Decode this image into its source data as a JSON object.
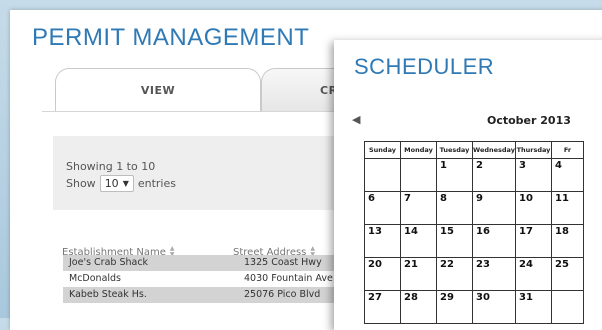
{
  "permit": {
    "title": "PERMIT MANAGEMENT",
    "tabs": [
      {
        "label": "VIEW"
      },
      {
        "label": "CRE"
      }
    ],
    "showing": "Showing 1 to 10",
    "show_label": "Show",
    "entries_value": "10",
    "entries_label": "entries",
    "columns": [
      "Establishment Name",
      "Street Address"
    ],
    "rows": [
      {
        "name": "Joe's Crab Shack",
        "address": "1325 Coast Hwy"
      },
      {
        "name": "McDonalds",
        "address": "4030 Fountain Ave"
      },
      {
        "name": "Kabeb Steak Hs.",
        "address": "25076 Pico Blvd"
      }
    ],
    "row_colors": [
      "#d3d3d3",
      "#ffffff",
      "#d3d3d3"
    ]
  },
  "scheduler": {
    "title": "SCHEDULER",
    "month": "October 2013",
    "weekdays": [
      "Sunday",
      "Monday",
      "Tuesday",
      "Wednesday",
      "Thursday",
      "Fr"
    ],
    "weeks": [
      [
        "",
        "",
        "1",
        "2",
        "3",
        "4"
      ],
      [
        "6",
        "7",
        "8",
        "9",
        "10",
        "11"
      ],
      [
        "13",
        "14",
        "15",
        "16",
        "17",
        "18"
      ],
      [
        "20",
        "21",
        "22",
        "23",
        "24",
        "25"
      ],
      [
        "27",
        "28",
        "29",
        "30",
        "31",
        ""
      ]
    ]
  }
}
